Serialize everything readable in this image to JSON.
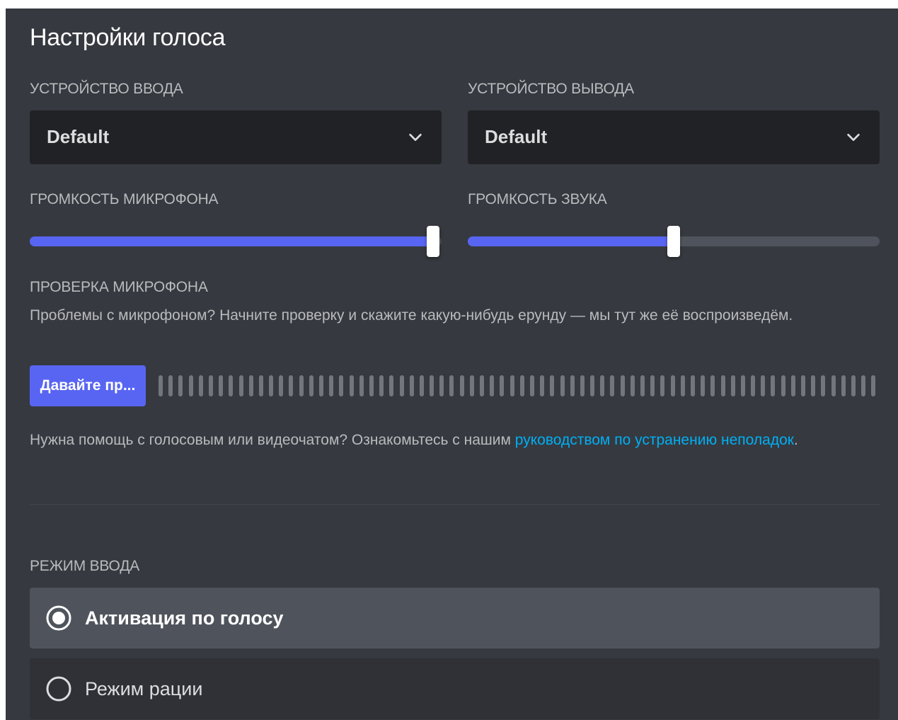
{
  "page": {
    "title": "Настройки голоса"
  },
  "input_device": {
    "label": "УСТРОЙСТВО ВВОДА",
    "value": "Default"
  },
  "output_device": {
    "label": "УСТРОЙСТВО ВЫВОДА",
    "value": "Default"
  },
  "mic_volume": {
    "label": "ГРОМКОСТЬ МИКРОФОНА",
    "level_percent": 98
  },
  "output_volume": {
    "label": "ГРОМКОСТЬ ЗВУКА",
    "level_percent": 50
  },
  "mic_test": {
    "label": "ПРОВЕРКА МИКРОФОНА",
    "description": "Проблемы с микрофоном? Начните проверку и скажите какую-нибудь ерунду — мы тут же её воспроизведём.",
    "button_label": "Давайте пр...",
    "meter_level_percent": 0
  },
  "help": {
    "text_before": "Нужна помощь с голосовым или видеочатом? Ознакомьтесь с нашим ",
    "link_text": "руководством по устранению неполадок",
    "text_after": "."
  },
  "input_mode": {
    "label": "РЕЖИМ ВВОДА",
    "options": [
      {
        "label": "Активация по голосу",
        "selected": true
      },
      {
        "label": "Режим рации",
        "selected": false
      }
    ]
  },
  "colors": {
    "background": "#36393f",
    "select_background": "#202225",
    "accent": "#5865f2",
    "link": "#00aff4",
    "label_text": "#b9bbbe"
  },
  "icons": {
    "dropdown": "chevron-down-icon",
    "radio_on": "radio-selected-icon",
    "radio_off": "radio-unselected-icon"
  }
}
